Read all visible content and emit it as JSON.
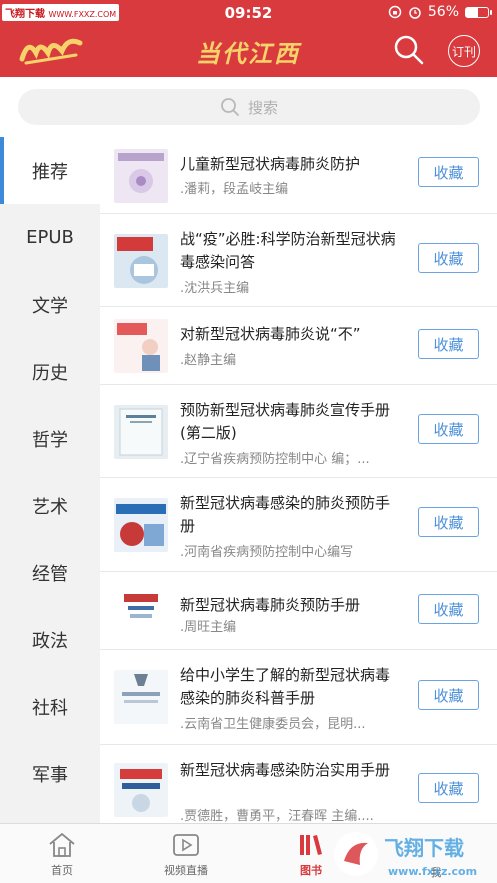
{
  "status_bar": {
    "carrier": "飞翔下载",
    "url": "WWW.FXXZ.COM",
    "time": "09:52",
    "battery": "56%",
    "battery_level": 0.56
  },
  "header": {
    "brand": "当代江西",
    "subscribe_label": "订刊"
  },
  "search": {
    "placeholder": "搜索"
  },
  "sidebar": {
    "items": [
      {
        "label": "推荐",
        "active": true
      },
      {
        "label": "EPUB"
      },
      {
        "label": "文学"
      },
      {
        "label": "历史"
      },
      {
        "label": "哲学"
      },
      {
        "label": "艺术"
      },
      {
        "label": "经管"
      },
      {
        "label": "政法"
      },
      {
        "label": "社科"
      },
      {
        "label": "军事"
      }
    ]
  },
  "books": [
    {
      "title": "儿童新型冠状病毒肺炎防护",
      "author": ".潘莉，段孟岐主编",
      "action": "收藏"
    },
    {
      "title": "战“疫”必胜:科学防治新型冠状病毒感染问答",
      "author": ".沈洪兵主编",
      "action": "收藏"
    },
    {
      "title": "对新型冠状病毒肺炎说“不”",
      "author": ".赵静主编",
      "action": "收藏"
    },
    {
      "title": "预防新型冠状病毒肺炎宣传手册(第二版)",
      "author": ".辽宁省疾病预防控制中心 编；...",
      "action": "收藏"
    },
    {
      "title": "新型冠状病毒感染的肺炎预防手册",
      "author": ".河南省疾病预防控制中心编写",
      "action": "收藏"
    },
    {
      "title": "新型冠状病毒肺炎预防手册",
      "author": ".周旺主编",
      "action": "收藏"
    },
    {
      "title": "给中小学生了解的新型冠状病毒感染的肺炎科普手册",
      "author": ".云南省卫生健康委员会，昆明...",
      "action": "收藏"
    },
    {
      "title": "新型冠状病毒感染防治实用手册",
      "author": ".贾德胜，曹勇平，汪春晖 主编....",
      "action": "收藏"
    }
  ],
  "tabs": [
    {
      "label": "首页"
    },
    {
      "label": "视频直播"
    },
    {
      "label": "图书",
      "active": true
    },
    {
      "label": "我"
    }
  ],
  "watermark": {
    "text": "飞翔下载",
    "url": "www.fxxz.com"
  },
  "colors": {
    "brand_red": "#d83a3d",
    "accent_blue": "#3c8ad9",
    "gold": "#f5d36a"
  }
}
